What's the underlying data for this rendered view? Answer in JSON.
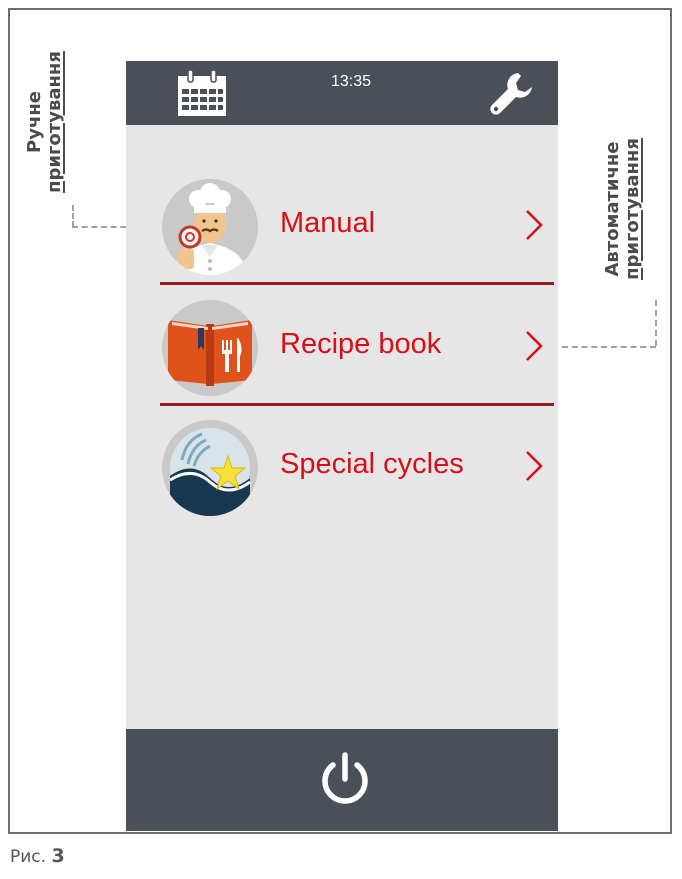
{
  "figure_caption": {
    "prefix": "Рис.",
    "number": "3"
  },
  "callouts": {
    "left": {
      "line1": "Ручне",
      "line2": "приготування"
    },
    "right": {
      "line1": "Автоматичне",
      "line2": "приготування"
    }
  },
  "topbar": {
    "time": "13:35",
    "left_icon": "calendar-icon",
    "right_icon": "wrench-icon"
  },
  "menu": [
    {
      "label": "Manual",
      "icon": "chef-icon"
    },
    {
      "label": "Recipe book",
      "icon": "recipe-book-icon"
    },
    {
      "label": "Special cycles",
      "icon": "special-cycles-icon"
    }
  ],
  "bottombar": {
    "icon": "power-icon"
  },
  "colors": {
    "bar": "#4a5057",
    "accent": "#d4111a",
    "screen_bg": "#e6e6e6"
  }
}
